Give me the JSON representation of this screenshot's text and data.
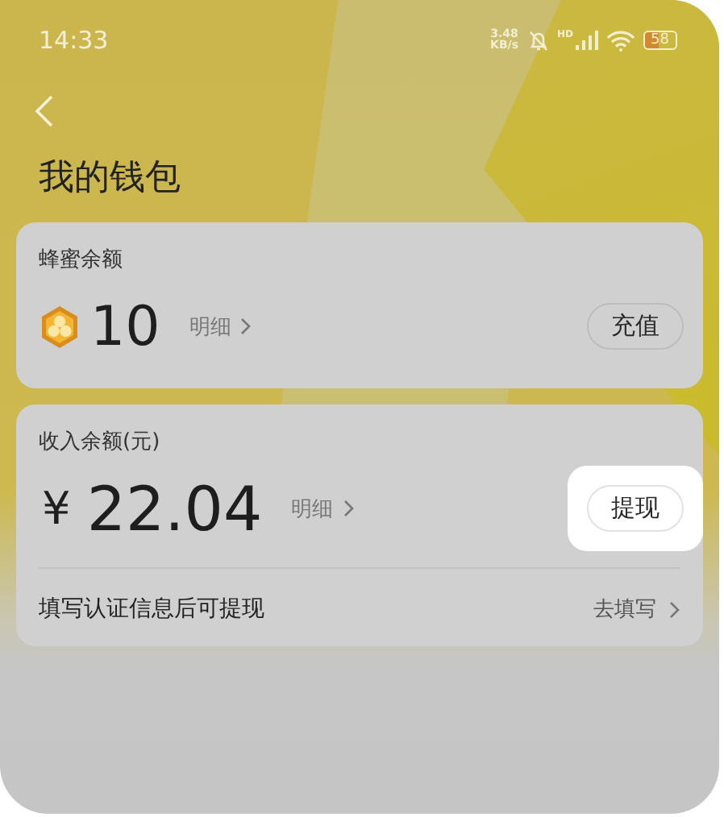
{
  "status_bar": {
    "time": "14:33",
    "network_speed": [
      "3.48",
      "KB/s"
    ],
    "signal_label": "HD",
    "battery": "58"
  },
  "header": {
    "title": "我的钱包"
  },
  "honey_card": {
    "label": "蜂蜜余额",
    "amount": "10",
    "detail_link": "明细",
    "button": {
      "label": "充值",
      "highlighted": false
    }
  },
  "income_card": {
    "label": "收入余额(元)",
    "currency": "¥",
    "amount": "22.04",
    "detail_link": "明细",
    "button": {
      "label": "提现",
      "highlighted": true
    },
    "notice": "填写认证信息后可提现",
    "notice_action": "去填写"
  }
}
